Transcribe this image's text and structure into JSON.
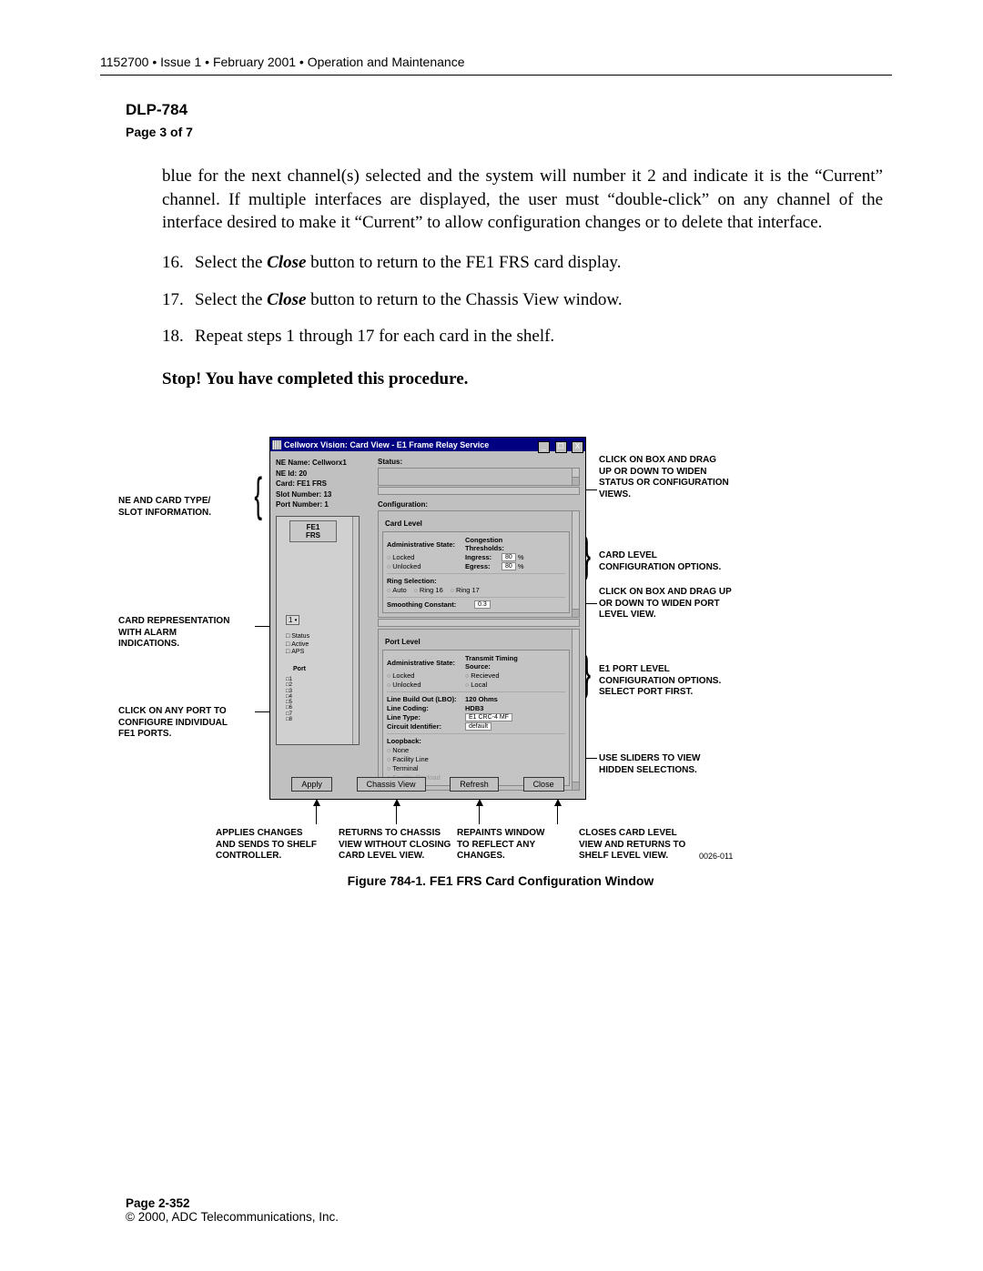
{
  "header": "1152700 • Issue 1 • February 2001 • Operation and Maintenance",
  "dlp": "DLP-784",
  "page_of": "Page 3 of 7",
  "para_intro": "blue for the next channel(s) selected and the system will number it 2 and indicate it is the “Current” channel. If multiple interfaces are displayed, the user must “double-click” on any channel of the interface desired to make it “Current” to allow configuration changes or to delete that interface.",
  "steps": {
    "s16": {
      "n": "16.",
      "pre": "Select the ",
      "cmd": "Close",
      "post": " button to return to the FE1 FRS card display."
    },
    "s17": {
      "n": "17.",
      "pre": "Select the ",
      "cmd": "Close",
      "post": " button to return to the Chassis View window."
    },
    "s18": {
      "n": "18.",
      "text": "Repeat steps 1 through 17 for each card in the shelf."
    }
  },
  "completed": "Stop! You have completed this procedure.",
  "window": {
    "title": "Cellworx Vision:   Card View - E1 Frame Relay Service",
    "min": "_",
    "max": "☐",
    "close": "X",
    "info": {
      "ne_name_l": "NE Name:",
      "ne_name_v": "Cellworx1",
      "ne_id_l": "NE Id:",
      "ne_id_v": "20",
      "card_l": "Card:",
      "card_v": "FE1 FRS",
      "slot_l": "Slot Number:",
      "slot_v": "13",
      "port_l": "Port Number:",
      "port_v": "1"
    },
    "card_label_1": "FE1",
    "card_label_2": "FRS",
    "port_mini": "1 •",
    "legend": {
      "status": "Status",
      "active": "Active",
      "aps": "APS"
    },
    "port_header": "Port",
    "ports": [
      "1",
      "2",
      "3",
      "4",
      "5",
      "6",
      "7",
      "8"
    ],
    "status_label": "Status:",
    "config_label": "Configuration:",
    "card_level": {
      "title": "Card Level",
      "admin": "Administrative State:",
      "cong": "Congestion Thresholds:",
      "locked": "Locked",
      "unlocked": "Unlocked",
      "ingress": "Ingress:",
      "egress": "Egress:",
      "pct": "%",
      "v80": "80",
      "ring_sel": "Ring Selection:",
      "auto": "Auto",
      "ring16": "Ring 16",
      "ring17": "Ring 17",
      "smooth": "Smoothing Constant:",
      "smooth_v": "0.3"
    },
    "port_level": {
      "title": "Port Level",
      "admin": "Administrative State:",
      "tts": "Transmit Timing Source:",
      "locked": "Locked",
      "unlocked": "Unlocked",
      "recv": "Recieved",
      "local": "Local",
      "lbo": "Line Build Out (LBO):",
      "lbo_v": "120 Ohms",
      "lc": "Line Coding:",
      "lc_v": "HDB3",
      "lt": "Line Type:",
      "lt_v": "E1 CRC-4 MF",
      "ci": "Circuit Identifier:",
      "ci_v": "default",
      "loop": "Loopback:",
      "none": "None",
      "fl": "Facility Line",
      "term": "Terminal",
      "fp": "Facility Payload"
    },
    "buttons": {
      "apply": "Apply",
      "chassis": "Chassis View",
      "refresh": "Refresh",
      "close": "Close"
    }
  },
  "callouts": {
    "left1": "NE AND CARD TYPE/\nSLOT INFORMATION.",
    "left2": "CARD REPRESENTATION\nWITH ALARM\nINDICATIONS.",
    "left3": "CLICK ON ANY PORT TO\nCONFIGURE INDIVIDUAL\nFE1 PORTS.",
    "right1": "CLICK ON BOX AND DRAG\nUP OR DOWN TO WIDEN\nSTATUS OR CONFIGURATION\nVIEWS.",
    "right2": "CARD LEVEL\nCONFIGURATION OPTIONS.",
    "right3": "CLICK ON BOX AND DRAG UP\nOR DOWN TO WIDEN PORT\nLEVEL VIEW.",
    "right4": "E1 PORT LEVEL\nCONFIGURATION OPTIONS.\nSELECT PORT FIRST.",
    "right5": "USE SLIDERS TO VIEW\nHIDDEN SELECTIONS.",
    "bottom1": "APPLIES CHANGES\nAND SENDS TO SHELF\nCONTROLLER.",
    "bottom2": "RETURNS TO CHASSIS\nVIEW WITHOUT CLOSING\nCARD LEVEL VIEW.",
    "bottom3": "REPAINTS WINDOW\nTO REFLECT ANY\nCHANGES.",
    "bottom4": "CLOSES CARD LEVEL\nVIEW AND RETURNS TO\nSHELF LEVEL VIEW."
  },
  "figure_caption": "Figure 784-1. FE1 FRS Card Configuration Window",
  "figure_id": "0026-011",
  "footer": {
    "page": "Page 2-352",
    "copy": "© 2000, ADC Telecommunications, Inc."
  }
}
